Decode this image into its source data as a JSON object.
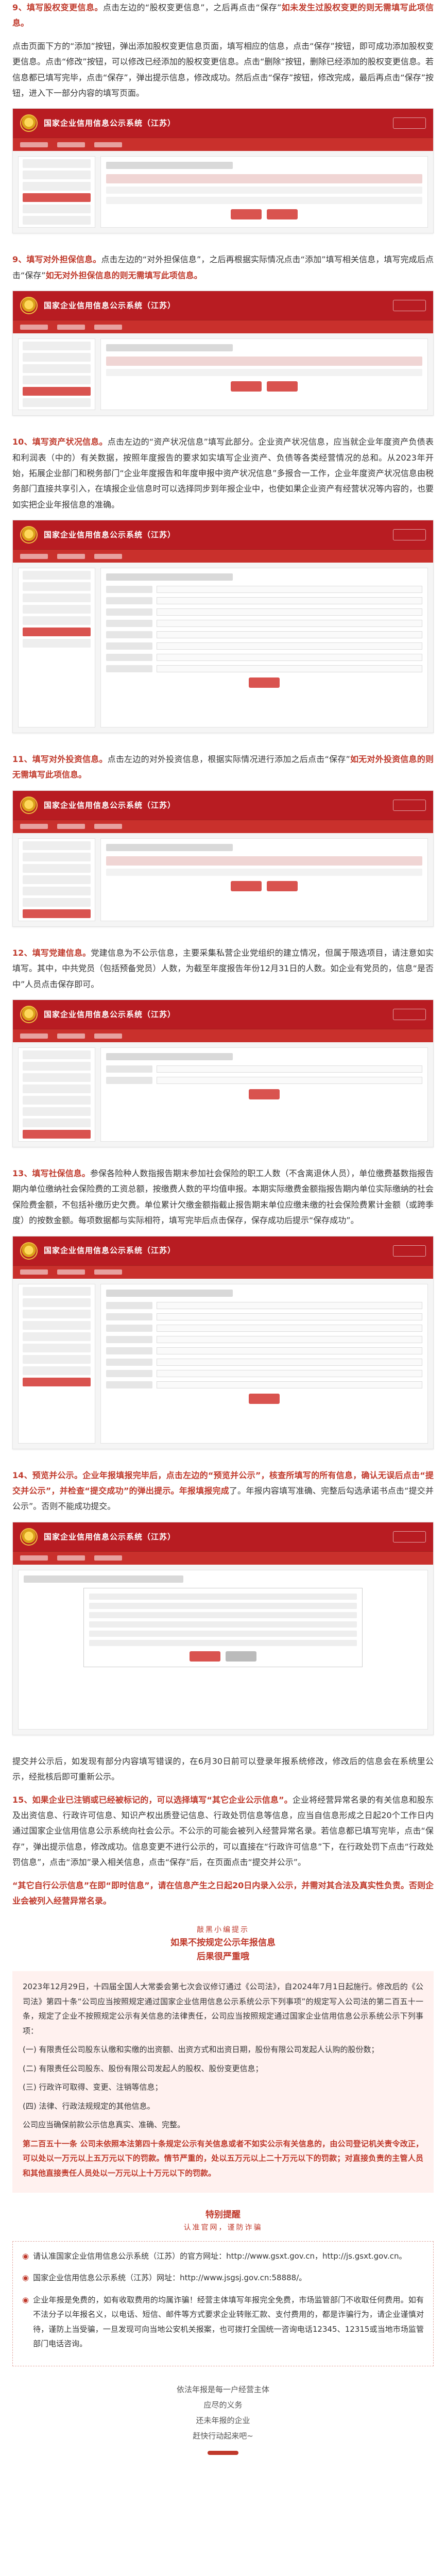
{
  "system_title": "国家企业信用信息公示系统（江苏）",
  "step9": {
    "num": "9、",
    "lead": "填写股权变更信息。",
    "text1": "点击左边的“股权变更信息”，之后再点击“保存”",
    "text2": "如未发生过股权变更的则无需填写此项信息。",
    "text3": "点击页面下方的“添加”按钮，弹出添加股权变更信息页面，填写相应的信息，点击“保存”按钮，即可成功添加股权变更信息。点击“修改”按钮，可以修改已经添加的股权变更信息。点击“删除”按钮，删除已经添加的股权变更信息。若信息都已填写完毕，点击“保存”，弹出提示信息，修改成功。然后点击“保存”按钮，修改完成，最后再点击“保存”按钮，进入下一部分内容的填写页面。"
  },
  "step10a": {
    "num": "9、",
    "lead": "填写对外担保信息。",
    "text1": "点击左边的“对外担保信息”，之后再根据实际情况点击“添加”填写相关信息，填写完成后点击“保存”",
    "text2": "如无对外担保信息的则无需填写此项信息。"
  },
  "step10": {
    "num": "10、",
    "lead": "填写资产状况信息。",
    "text": "点击左边的“资产状况信息”填写此部分。企业资产状况信息，应当就企业年度资产负债表和利润表（中的）有关数据，按照年度报告的要求如实填写企业资产、负债等各类经营情况的总和。从2023年开始，拓展企业部门和税务部门“企业年度报告和年度申报中资产状况信息”多报合一工作，企业年度资产状况信息由税务部门直接共享引入，在填报企业信息时可以选择同步到年报企业中，也使如果企业资产有经营状况等内容的，也要如实把企业年报信息的准确。"
  },
  "step11": {
    "num": "11、",
    "lead": "填写对外投资信息。",
    "text1": "点击左边的对外投资信息，根据实际情况进行添加之后点击“保存”",
    "text2": "如无对外投资信息的则无需填写此项信息。"
  },
  "step12": {
    "num": "12、",
    "lead": "填写党建信息。",
    "text": "党建信息为不公示信息，主要采集私营企业党组织的建立情况，但属于限选项目，请注意如实填写。其中，中共党员（包括预备党员）人数，为截至年度报告年份12月31日的人数。如企业有党员的，信息“是否中”人员点击保存即可。"
  },
  "step13": {
    "num": "13、",
    "lead": "填写社保信息。",
    "text": "参保各险种人数指报告期末参加社会保险的职工人数（不含离退休人员），单位缴费基数指报告期内单位缴纳社会保险费的工资总额，按缴费人数的平均值申报。本期实际缴费金额指报告期内单位实际缴纳的社会保险费金额，不包括补缴历史欠费。单位累计欠缴金额指截止报告期末单位应缴未缴的社会保险费累计金额（或跨季度）的按数金额。每项数据都与实际相符，填写完毕后点击保存，保存成功后提示“保存成功”。"
  },
  "step14": {
    "num": "14、",
    "lead": "预览并公示。",
    "text1": "企业年报填报完毕后，点击左边的“预览并公示”，核查所填写的所有信息，确认无误后点击“提交并公示”，并检查“提交成功”的弹出提示。年报填报完成",
    "text2": "了。年报内容填写准确、完整后勾选承诺书点击“提交并公示”。否则不能成功提交。",
    "text3": "提交并公示后，如发现有部分内容填写错误的，在6月30日前可以登录年报系统修改，修改后的信息会在系统里公示，经批核后即可重新公示。"
  },
  "step15": {
    "num": "15、",
    "lead": "如果企业已注销或已经被标记的，",
    "lead2": "可以选择填写“其它企业公示信息”。",
    "text": "企业将经营异常名录的有关信息和股东及出资信息、行政许可信息、知识产权出质登记信息、行政处罚信息等信息，应当自信息形成之日起20个工作日内通过国家企业信用信息公示系统向社会公示。不公示的可能会被列入经营异常名录。若信息都已填写完毕，点击“保存”，弹出提示信息，修改成功。信息变更不进行公示的，可以直接在“行政许可信息”下，在行政处罚下点击“行政处罚信息”，点击“添加”录入相关信息，点击“保存”后，在页面点击“提交并公示”。",
    "note": "“其它自行公示信息”在即“即时信息”，请在信息产生之日起20日内录入公示，并需对其合法及真实性负责。否则企业会被列入经营异常名录。"
  },
  "reminder": {
    "title1": "敲黑小编提示",
    "title2": "如果不按规定公示年报信息",
    "title3": "后果很严重哦",
    "p1": "2023年12月29日，十四届全国人大常委会第七次会议修订通过《公司法》，自2024年7月1日起施行。修改后的《公司法》第四十条“公司应当按照规定通过国家企业信用信息公示系统公示下列事项”的规定写入公司法的第二百五十一条，规定了企业不按照规定公示有关信息的法律责任，公司应当按照规定通过国家企业信用信息公示系统公示下列事项：",
    "items": [
      "(一) 有限责任公司股东认缴和实缴的出资额、出资方式和出资日期，股份有限公司发起人认购的股份数；",
      "(二) 有限责任公司股东、股份有限公司发起人的股权、股份变更信息；",
      "(三) 行政许可取得、变更、注销等信息；",
      "(四) 法律、行政法规规定的其他信息。"
    ],
    "p2": "公司应当确保前款公示信息真实、准确、完整。",
    "p3": "第二百五十一条 公司未依照本法第四十条规定公示有关信息或者不如实公示有关信息的，由公司登记机关责令改正，可以处以一万元以上五万元以下的罚款。情节严重的，处以五万元以上二十万元以下的罚款；对直接负责的主管人员和其他直接责任人员处以一万元以上十万元以下的罚款。"
  },
  "special": {
    "title": "特别提醒",
    "subtitle": "认准官网，谨防诈骗",
    "s1": "请认准国家企业信用信息公示系统（江苏）的官方网址：http://www.gsxt.gov.cn，http://js.gsxt.gov.cn。",
    "s2": "国家企业信用信息公示系统（江苏）网址：http://www.jsgsj.gov.cn:58888/。",
    "s3": "企业年报是免费的，如有收取费用的均属诈骗！经营主体填写年报完全免费，市场监管部门不收取任何费用。如有不法分子以年报名义，以电话、短信、邮件等方式要求企业转账汇款、支付费用的，都是诈骗行为，请企业谨慎对待，谨防上当受骗，一旦发现可向当地公安机关报案，也可拨打全国统一咨询电话12345、12315或当地市场监管部门电话咨询。"
  },
  "footer": {
    "l1": "依法年报是每一户经营主体",
    "l2": "应尽的义务",
    "l3": "还未年报的企业",
    "l4": "赶快行动起来吧~"
  }
}
